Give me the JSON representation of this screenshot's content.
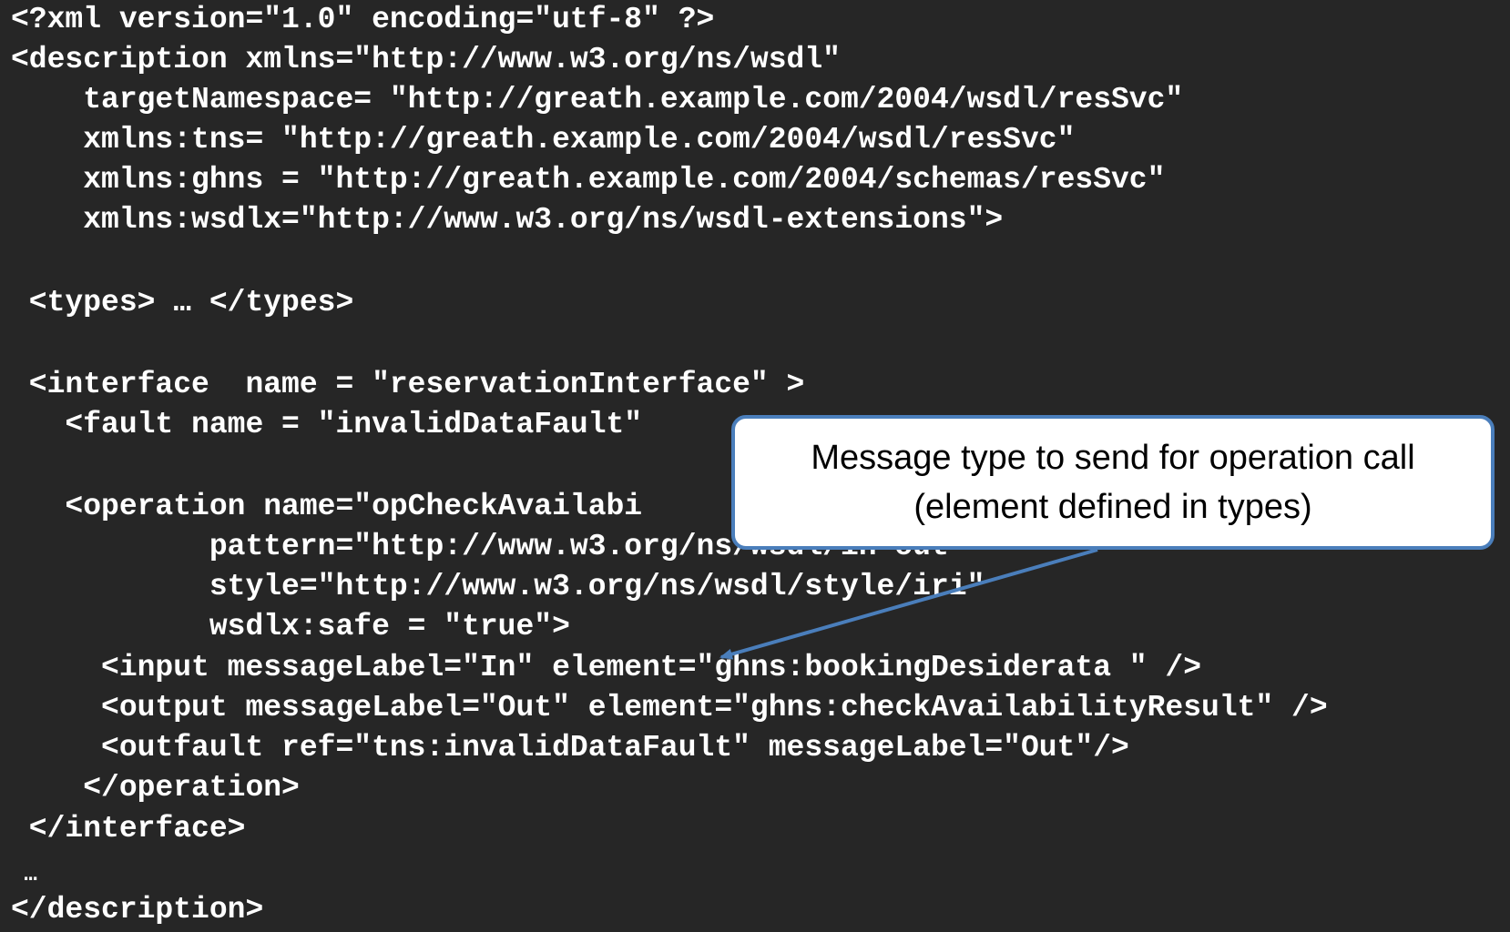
{
  "code_lines": [
    "<?xml version=\"1.0\" encoding=\"utf-8\" ?>",
    "<description xmlns=\"http://www.w3.org/ns/wsdl\"",
    "    targetNamespace= \"http://greath.example.com/2004/wsdl/resSvc\"",
    "    xmlns:tns= \"http://greath.example.com/2004/wsdl/resSvc\"",
    "    xmlns:ghns = \"http://greath.example.com/2004/schemas/resSvc\"",
    "    xmlns:wsdlx=\"http://www.w3.org/ns/wsdl-extensions\">",
    " <types> … </types>",
    " <interface  name = \"reservationInterface\" >",
    "   <fault name = \"invalidDataFault\"",
    "   <operation name=\"opCheckAvailabi",
    "           pattern=\"http://www.w3.org/ns/wsdl/in-out\"",
    "           style=\"http://www.w3.org/ns/wsdl/style/iri\"",
    "           wsdlx:safe = \"true\">",
    "     <input messageLabel=\"In\" element=\"ghns:bookingDesiderata \" />",
    "     <output messageLabel=\"Out\" element=\"ghns:checkAvailabilityResult\" />",
    "     <outfault ref=\"tns:invalidDataFault\" messageLabel=\"Out\"/>",
    "    </operation>",
    " </interface>",
    " …",
    "</description>"
  ],
  "callout": {
    "line1": "Message type to send for operation call",
    "line2": "(element defined in types)"
  },
  "colors": {
    "background": "#262626",
    "code_text": "#ffffff",
    "callout_border": "#4a7ebb",
    "arrow": "#4a7ebb"
  }
}
